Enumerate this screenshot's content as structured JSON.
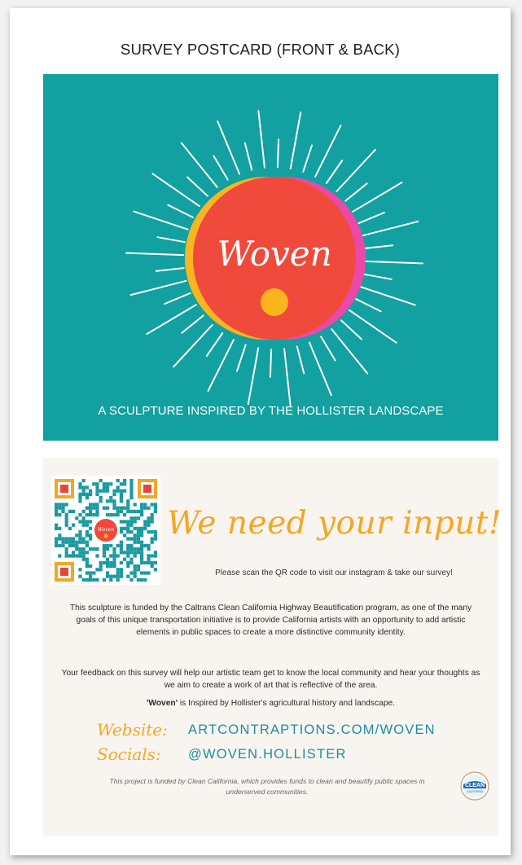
{
  "title": "SURVEY POSTCARD (FRONT & BACK)",
  "front": {
    "logo_word": "Woven",
    "caption": "A SCULPTURE INSPIRED BY THE HOLLISTER LANDSCAPE",
    "colors": {
      "background": "#12a0a0",
      "sun": "#f04a3c",
      "dot": "#f9b51b",
      "rim_yellow": "#f7b620",
      "rim_pink": "#e94aa9"
    }
  },
  "back": {
    "qr_logo_word": "Woven",
    "headline": "We need your input!",
    "scan_text": "Please scan the QR code to visit our instagram & take our survey!",
    "paragraph_1": "This sculpture is funded by the Caltrans Clean California Highway Beautification program, as one of the many goals of this unique transportation initiative is to provide California artists with an opportunity to add artistic elements in public spaces to create a more distinctive community identity.",
    "paragraph_2": "Your feedback on this survey will help our artistic team get to know the local community and hear your thoughts  as we aim to create a work of art that is reflective of the area.",
    "paragraph_3_bold": "'Woven'",
    "paragraph_3_rest": " is Inspired by Hollister's agricultural history and landscape.",
    "website_label": "Website:",
    "website_value": "ARTCONTRAPTIONS.COM/WOVEN",
    "socials_label": "Socials:",
    "socials_value": "@WOVEN.HOLLISTER",
    "footnote": "This project is funded by Clean California, which provides funds to clean and beautify public spaces in underserved communities.",
    "clean_logo_top": "CLEAN",
    "clean_logo_bottom": "CALIFORNIA",
    "colors": {
      "accent_orange": "#f5a623",
      "link_teal": "#1b8fa0",
      "qr_teal": "#1a9aa0"
    }
  }
}
